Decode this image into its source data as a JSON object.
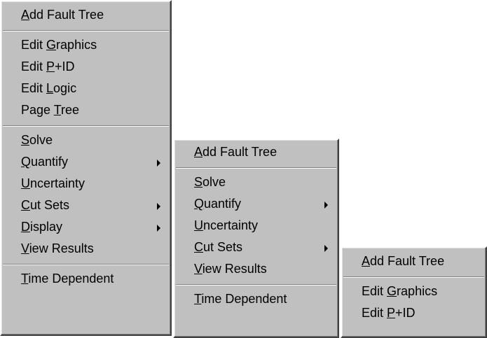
{
  "menu1": {
    "items": [
      {
        "pre": "",
        "mn": "A",
        "post": "dd Fault Tree"
      },
      {
        "pre": "Edit ",
        "mn": "G",
        "post": "raphics"
      },
      {
        "pre": "Edit ",
        "mn": "P",
        "post": "+ID"
      },
      {
        "pre": "Edit ",
        "mn": "L",
        "post": "ogic"
      },
      {
        "pre": "Page ",
        "mn": "T",
        "post": "ree"
      },
      {
        "pre": "",
        "mn": "S",
        "post": "olve"
      },
      {
        "pre": "",
        "mn": "Q",
        "post": "uantify"
      },
      {
        "pre": "",
        "mn": "U",
        "post": "ncertainty"
      },
      {
        "pre": "",
        "mn": "C",
        "post": "ut Sets"
      },
      {
        "pre": "",
        "mn": "D",
        "post": "isplay"
      },
      {
        "pre": "",
        "mn": "V",
        "post": "iew Results"
      },
      {
        "pre": "",
        "mn": "T",
        "post": "ime Dependent"
      }
    ]
  },
  "menu2": {
    "items": [
      {
        "pre": "",
        "mn": "A",
        "post": "dd Fault Tree"
      },
      {
        "pre": "",
        "mn": "S",
        "post": "olve"
      },
      {
        "pre": "",
        "mn": "Q",
        "post": "uantify"
      },
      {
        "pre": "",
        "mn": "U",
        "post": "ncertainty"
      },
      {
        "pre": "",
        "mn": "C",
        "post": "ut Sets"
      },
      {
        "pre": "",
        "mn": "V",
        "post": "iew Results"
      },
      {
        "pre": "",
        "mn": "T",
        "post": "ime Dependent"
      }
    ]
  },
  "menu3": {
    "items": [
      {
        "pre": "",
        "mn": "A",
        "post": "dd Fault Tree"
      },
      {
        "pre": "Edit ",
        "mn": "G",
        "post": "raphics"
      },
      {
        "pre": "Edit ",
        "mn": "P",
        "post": "+ID"
      }
    ]
  }
}
